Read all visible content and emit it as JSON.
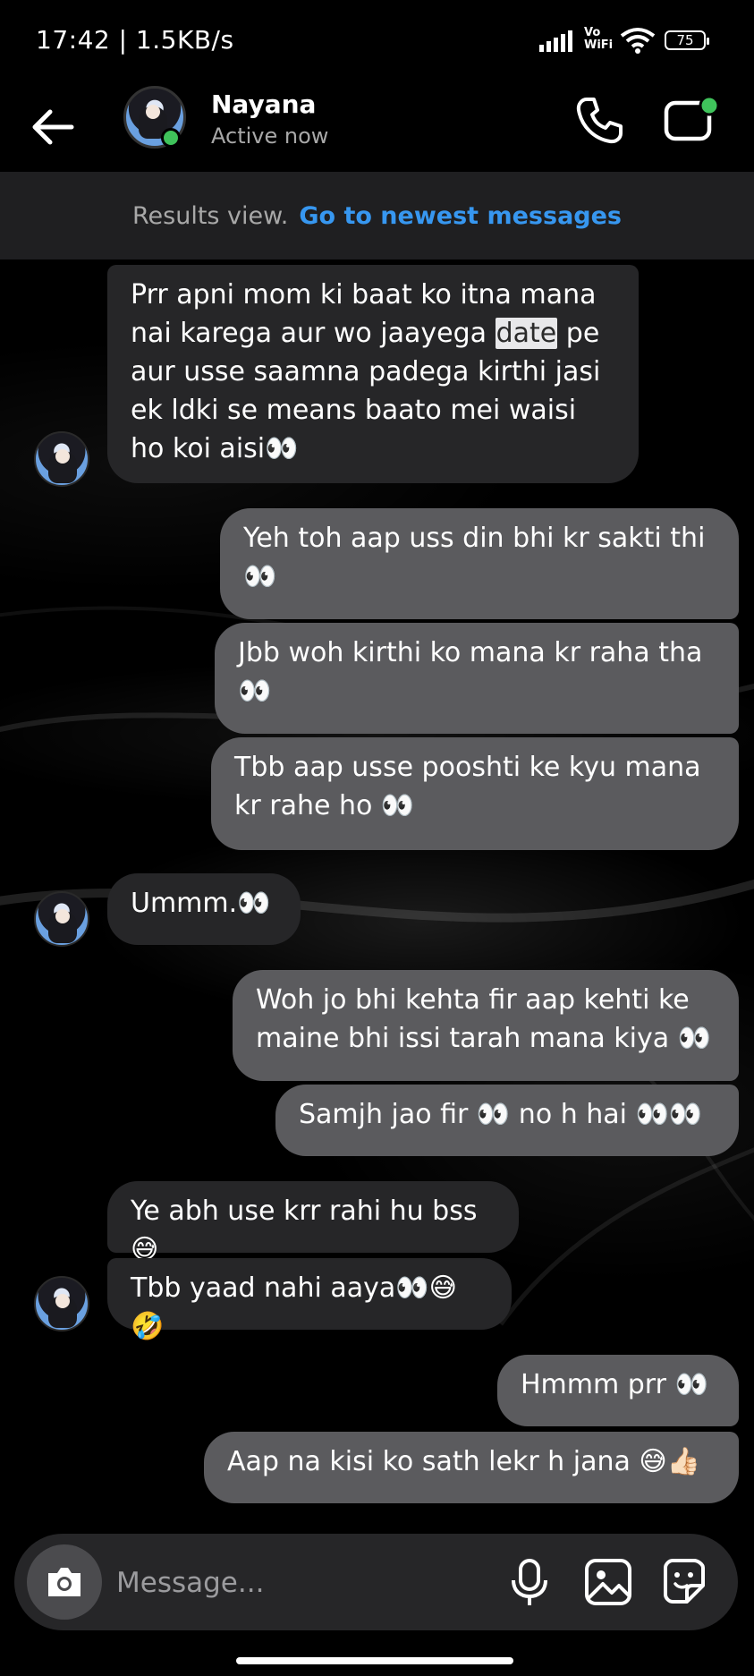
{
  "status_bar": {
    "time": "17:42 | 1.5KB/s",
    "vowifi": "Vo\nWiFi",
    "battery": "75"
  },
  "header": {
    "contact_name": "Nayana",
    "contact_status": "Active now",
    "icons": [
      "back-arrow-icon",
      "phone-icon",
      "video-call-icon"
    ]
  },
  "results_banner": {
    "label": "Results view.",
    "link": "Go to newest messages"
  },
  "messages": [
    {
      "id": 0,
      "direction": "in",
      "text_before": "Prr apni mom ki baat ko itna mana nai karega aur wo jaayega ",
      "highlight": "date",
      "text_after": " pe aur usse saamna padega kirthi jasi ek ldki se means baato mei waisi ho koi aisi👀"
    },
    {
      "id": 1,
      "direction": "out",
      "text": "Yeh toh aap uss din bhi kr sakti thi 👀"
    },
    {
      "id": 2,
      "direction": "out",
      "text": "Jbb woh kirthi ko mana kr raha tha 👀"
    },
    {
      "id": 3,
      "direction": "out",
      "text": "Tbb aap usse pooshti ke kyu mana kr rahe ho 👀"
    },
    {
      "id": 4,
      "direction": "in",
      "text": "Ummm.👀"
    },
    {
      "id": 5,
      "direction": "out",
      "text": "Woh jo bhi kehta fir aap kehti ke maine bhi issi tarah mana kiya 👀"
    },
    {
      "id": 6,
      "direction": "out",
      "text": "Samjh jao fir 👀 no h hai 👀👀"
    },
    {
      "id": 7,
      "direction": "in",
      "text": "Ye abh use krr rahi hu bss😅"
    },
    {
      "id": 8,
      "direction": "in",
      "text": "Tbb yaad nahi aaya👀😅🤣"
    },
    {
      "id": 9,
      "direction": "out",
      "text": "Hmmm prr 👀"
    },
    {
      "id": 10,
      "direction": "out",
      "text": "Aap na kisi ko sath lekr h jana 😅👍🏻"
    }
  ],
  "composer": {
    "placeholder": "Message...",
    "icons": [
      "camera-icon",
      "microphone-icon",
      "gallery-icon",
      "sticker-icon"
    ]
  }
}
